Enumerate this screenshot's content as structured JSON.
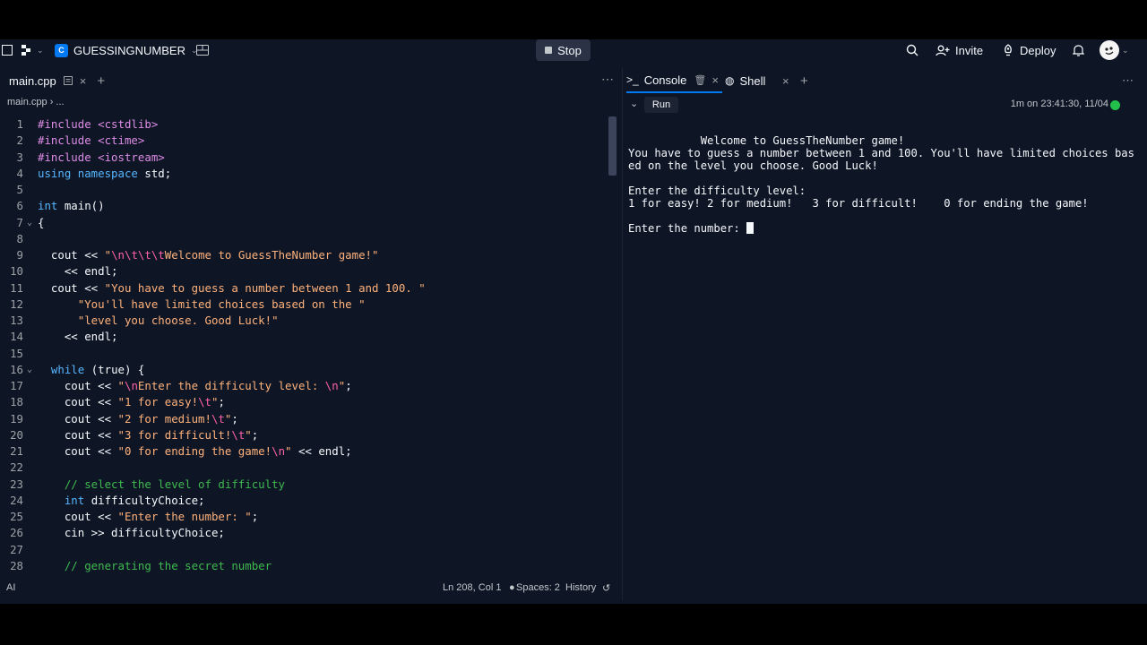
{
  "topbar": {
    "repl_name": "GUESSINGNUMBER",
    "stop_label": "Stop",
    "invite_label": "Invite",
    "deploy_label": "Deploy"
  },
  "left": {
    "tab_label": "main.cpp",
    "breadcrumb": "main.cpp  ›  ...",
    "status": {
      "ai": "AI",
      "position": "Ln 208, Col 1",
      "spaces": "Spaces: 2",
      "history": "History"
    }
  },
  "code_lines": [
    {
      "n": "1",
      "fold": "",
      "tokens": [
        [
          "t-pp",
          "#include <cstdlib>"
        ]
      ]
    },
    {
      "n": "2",
      "fold": "",
      "tokens": [
        [
          "t-pp",
          "#include <ctime>"
        ]
      ]
    },
    {
      "n": "3",
      "fold": "",
      "tokens": [
        [
          "t-pp",
          "#include <iostream>"
        ]
      ]
    },
    {
      "n": "4",
      "fold": "",
      "tokens": [
        [
          "t-kw",
          "using namespace "
        ],
        [
          "t-op",
          "std;"
        ]
      ]
    },
    {
      "n": "5",
      "fold": "",
      "tokens": []
    },
    {
      "n": "6",
      "fold": "",
      "tokens": [
        [
          "t-kw",
          "int "
        ],
        [
          "t-op",
          "main()"
        ]
      ]
    },
    {
      "n": "7",
      "fold": "⌄",
      "tokens": [
        [
          "t-op",
          "{"
        ]
      ]
    },
    {
      "n": "8",
      "fold": "",
      "tokens": []
    },
    {
      "n": "9",
      "fold": "",
      "tokens": [
        [
          "t-op",
          "  cout << "
        ],
        [
          "t-str",
          "\""
        ],
        [
          "t-esc",
          "\\n\\t\\t\\t"
        ],
        [
          "t-str",
          "Welcome to GuessTheNumber game!\""
        ]
      ]
    },
    {
      "n": "10",
      "fold": "",
      "tokens": [
        [
          "t-op",
          "    << endl;"
        ]
      ]
    },
    {
      "n": "11",
      "fold": "",
      "tokens": [
        [
          "t-op",
          "  cout << "
        ],
        [
          "t-str",
          "\"You have to guess a number between 1 and 100. \""
        ]
      ]
    },
    {
      "n": "12",
      "fold": "",
      "tokens": [
        [
          "t-str",
          "      \"You'll have limited choices based on the \""
        ]
      ]
    },
    {
      "n": "13",
      "fold": "",
      "tokens": [
        [
          "t-str",
          "      \"level you choose. Good Luck!\""
        ]
      ]
    },
    {
      "n": "14",
      "fold": "",
      "tokens": [
        [
          "t-op",
          "    << endl;"
        ]
      ]
    },
    {
      "n": "15",
      "fold": "",
      "tokens": []
    },
    {
      "n": "16",
      "fold": "⌄",
      "tokens": [
        [
          "t-kw",
          "  while "
        ],
        [
          "t-op",
          "(true) {"
        ]
      ]
    },
    {
      "n": "17",
      "fold": "",
      "tokens": [
        [
          "t-op",
          "    cout << "
        ],
        [
          "t-str",
          "\""
        ],
        [
          "t-esc",
          "\\n"
        ],
        [
          "t-str",
          "Enter the difficulty level: "
        ],
        [
          "t-esc",
          "\\n"
        ],
        [
          "t-str",
          "\""
        ],
        [
          "t-op",
          ";"
        ]
      ]
    },
    {
      "n": "18",
      "fold": "",
      "tokens": [
        [
          "t-op",
          "    cout << "
        ],
        [
          "t-str",
          "\"1 for easy!"
        ],
        [
          "t-esc",
          "\\t"
        ],
        [
          "t-str",
          "\""
        ],
        [
          "t-op",
          ";"
        ]
      ]
    },
    {
      "n": "19",
      "fold": "",
      "tokens": [
        [
          "t-op",
          "    cout << "
        ],
        [
          "t-str",
          "\"2 for medium!"
        ],
        [
          "t-esc",
          "\\t"
        ],
        [
          "t-str",
          "\""
        ],
        [
          "t-op",
          ";"
        ]
      ]
    },
    {
      "n": "20",
      "fold": "",
      "tokens": [
        [
          "t-op",
          "    cout << "
        ],
        [
          "t-str",
          "\"3 for difficult!"
        ],
        [
          "t-esc",
          "\\t"
        ],
        [
          "t-str",
          "\""
        ],
        [
          "t-op",
          ";"
        ]
      ]
    },
    {
      "n": "21",
      "fold": "",
      "tokens": [
        [
          "t-op",
          "    cout << "
        ],
        [
          "t-str",
          "\"0 for ending the game!"
        ],
        [
          "t-esc",
          "\\n"
        ],
        [
          "t-str",
          "\""
        ],
        [
          "t-op",
          " << endl;"
        ]
      ]
    },
    {
      "n": "22",
      "fold": "",
      "tokens": []
    },
    {
      "n": "23",
      "fold": "",
      "tokens": [
        [
          "t-cm",
          "    // select the level of difficulty"
        ]
      ]
    },
    {
      "n": "24",
      "fold": "",
      "tokens": [
        [
          "t-kw",
          "    int "
        ],
        [
          "t-op",
          "difficultyChoice;"
        ]
      ]
    },
    {
      "n": "25",
      "fold": "",
      "tokens": [
        [
          "t-op",
          "    cout << "
        ],
        [
          "t-str",
          "\"Enter the number: \""
        ],
        [
          "t-op",
          ";"
        ]
      ]
    },
    {
      "n": "26",
      "fold": "",
      "tokens": [
        [
          "t-op",
          "    cin >> difficultyChoice;"
        ]
      ]
    },
    {
      "n": "27",
      "fold": "",
      "tokens": []
    },
    {
      "n": "28",
      "fold": "",
      "tokens": [
        [
          "t-cm",
          "    // generating the secret number"
        ]
      ]
    }
  ],
  "right": {
    "console_tab": "Console",
    "shell_tab": "Shell",
    "run_label": "Run",
    "run_meta": "1m on 23:41:30, 11/04"
  },
  "console_lines": [
    "           Welcome to GuessTheNumber game!",
    "You have to guess a number between 1 and 100. You'll have limited choices bas",
    "ed on the level you choose. Good Luck!",
    "",
    "Enter the difficulty level:",
    "1 for easy! 2 for medium!   3 for difficult!    0 for ending the game!",
    ""
  ],
  "console_prompt": "Enter the number: ",
  "icons": {
    "sidebar_toggle": "sidebar-icon",
    "search": "search-icon",
    "bell": "bell-icon"
  }
}
